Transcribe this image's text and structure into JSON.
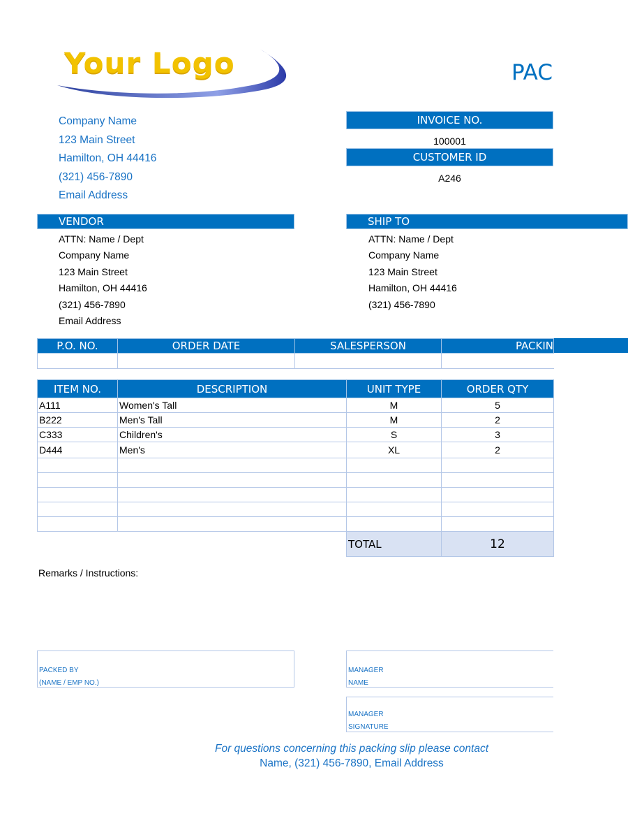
{
  "logo": {
    "text": "Your Logo"
  },
  "title": "PAC",
  "company": {
    "name": "Company Name",
    "street": "123 Main Street",
    "city": "Hamilton, OH  44416",
    "phone": "(321) 456-7890",
    "email": "Email Address"
  },
  "invoice": {
    "invoice_no_label": "INVOICE NO.",
    "invoice_no": "100001",
    "customer_id_label": "CUSTOMER ID",
    "customer_id": "A246"
  },
  "vendor": {
    "label": "VENDOR",
    "lines": [
      "ATTN: Name / Dept",
      "Company Name",
      "123 Main Street",
      "Hamilton, OH  44416",
      "(321) 456-7890",
      "Email Address"
    ]
  },
  "ship_to": {
    "label": "SHIP TO",
    "lines": [
      "ATTN: Name / Dept",
      "Company Name",
      "123 Main Street",
      "Hamilton, OH  44416",
      "(321) 456-7890"
    ]
  },
  "order_info": {
    "headers": [
      "P.O. NO.",
      "ORDER DATE",
      "SALESPERSON",
      "PACKIN"
    ],
    "values": [
      "",
      "",
      "",
      ""
    ]
  },
  "items": {
    "headers": [
      "ITEM NO.",
      "DESCRIPTION",
      "UNIT TYPE",
      "ORDER QTY"
    ],
    "rows": [
      [
        "A111",
        "Women's Tall",
        "M",
        "5"
      ],
      [
        "B222",
        "Men's Tall",
        "M",
        "2"
      ],
      [
        "C333",
        "Children's",
        "S",
        "3"
      ],
      [
        "D444",
        "Men's",
        "XL",
        "2"
      ],
      [
        "",
        "",
        "",
        ""
      ],
      [
        "",
        "",
        "",
        ""
      ],
      [
        "",
        "",
        "",
        ""
      ],
      [
        "",
        "",
        "",
        ""
      ],
      [
        "",
        "",
        "",
        ""
      ]
    ],
    "total_label": "TOTAL",
    "total_value": "12"
  },
  "remarks_label": "Remarks / Instructions:",
  "signatures": {
    "packed_by": [
      "PACKED BY",
      "(NAME / EMP NO.)"
    ],
    "manager_name": [
      "MANAGER",
      "NAME"
    ],
    "manager_signature": [
      "MANAGER",
      "SIGNATURE"
    ]
  },
  "footer": {
    "line1": "For questions concerning this packing slip please contact",
    "line2": "Name, (321) 456-7890, Email Address"
  },
  "colors": {
    "accent": "#0070c0",
    "text_blue": "#1a73c5",
    "grid": "#b4c7e7",
    "total_bg": "#d9e2f3",
    "logo_yellow": "#f2c200"
  }
}
